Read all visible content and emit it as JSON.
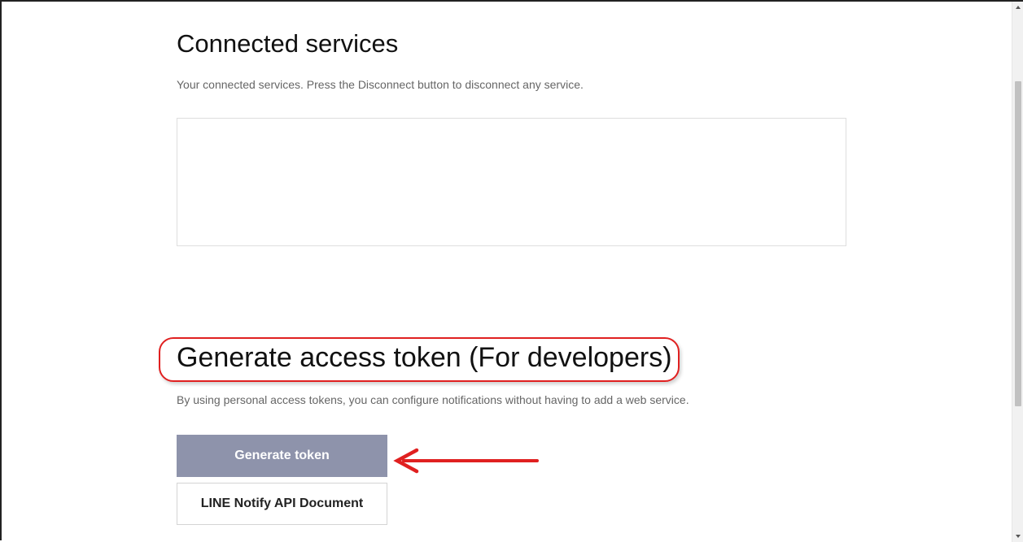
{
  "connected_services": {
    "title": "Connected services",
    "description": "Your connected services. Press the Disconnect button to disconnect any service."
  },
  "generate_token": {
    "title": "Generate access token (For developers)",
    "description": "By using personal access tokens, you can configure notifications without having to add a web service.",
    "generate_button_label": "Generate token",
    "doc_button_label": "LINE Notify API Document"
  },
  "annotation": {
    "highlight_color": "#e02020",
    "arrow_color": "#e02020"
  },
  "colors": {
    "generate_button_bg": "#8e93ab"
  },
  "icons": {
    "arrow": "left-arrow",
    "scroll_up": "scroll-up-arrow",
    "scroll_down": "scroll-down-arrow"
  }
}
